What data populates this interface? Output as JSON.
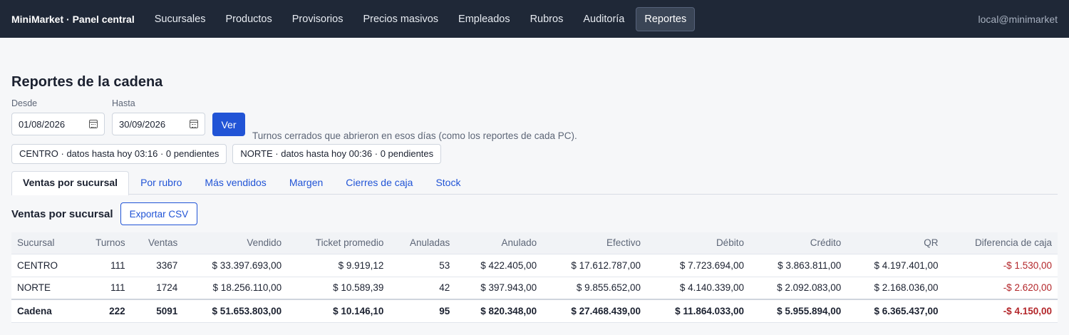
{
  "nav": {
    "brand": "MiniMarket · Panel central",
    "items": [
      "Sucursales",
      "Productos",
      "Provisorios",
      "Precios masivos",
      "Empleados",
      "Rubros",
      "Auditoría",
      "Reportes"
    ],
    "active_item": "Reportes",
    "user": "local@minimarket"
  },
  "page": {
    "title": "Reportes de la cadena"
  },
  "filters": {
    "desde_label": "Desde",
    "desde_value": "01/08/2026",
    "hasta_label": "Hasta",
    "hasta_value": "30/09/2026",
    "ver_label": "Ver",
    "hint": "Turnos cerrados que abrieron en esos días (como los reportes de cada PC)."
  },
  "sync_badges": [
    "CENTRO · datos hasta hoy 03:16 · 0 pendientes",
    "NORTE · datos hasta hoy 00:36 · 0 pendientes"
  ],
  "tabs": [
    "Ventas por sucursal",
    "Por rubro",
    "Más vendidos",
    "Margen",
    "Cierres de caja",
    "Stock"
  ],
  "active_tab": "Ventas por sucursal",
  "section": {
    "title": "Ventas por sucursal",
    "export_label": "Exportar CSV"
  },
  "table": {
    "headers": [
      "Sucursal",
      "Turnos",
      "Ventas",
      "Vendido",
      "Ticket promedio",
      "Anuladas",
      "Anulado",
      "Efectivo",
      "Débito",
      "Crédito",
      "QR",
      "Diferencia de caja"
    ],
    "rows": [
      [
        "CENTRO",
        "111",
        "3367",
        "$ 33.397.693,00",
        "$ 9.919,12",
        "53",
        "$ 422.405,00",
        "$ 17.612.787,00",
        "$ 7.723.694,00",
        "$ 3.863.811,00",
        "$ 4.197.401,00",
        "-$ 1.530,00"
      ],
      [
        "NORTE",
        "111",
        "1724",
        "$ 18.256.110,00",
        "$ 10.589,39",
        "42",
        "$ 397.943,00",
        "$ 9.855.652,00",
        "$ 4.140.339,00",
        "$ 2.092.083,00",
        "$ 2.168.036,00",
        "-$ 2.620,00"
      ],
      [
        "Cadena",
        "222",
        "5091",
        "$ 51.653.803,00",
        "$ 10.146,10",
        "95",
        "$ 820.348,00",
        "$ 27.468.439,00",
        "$ 11.864.033,00",
        "$ 5.955.894,00",
        "$ 6.365.437,00",
        "-$ 4.150,00"
      ]
    ]
  },
  "colors": {
    "navbar": "#1f2837",
    "accent": "#2154d6",
    "negative": "#b3262a"
  }
}
